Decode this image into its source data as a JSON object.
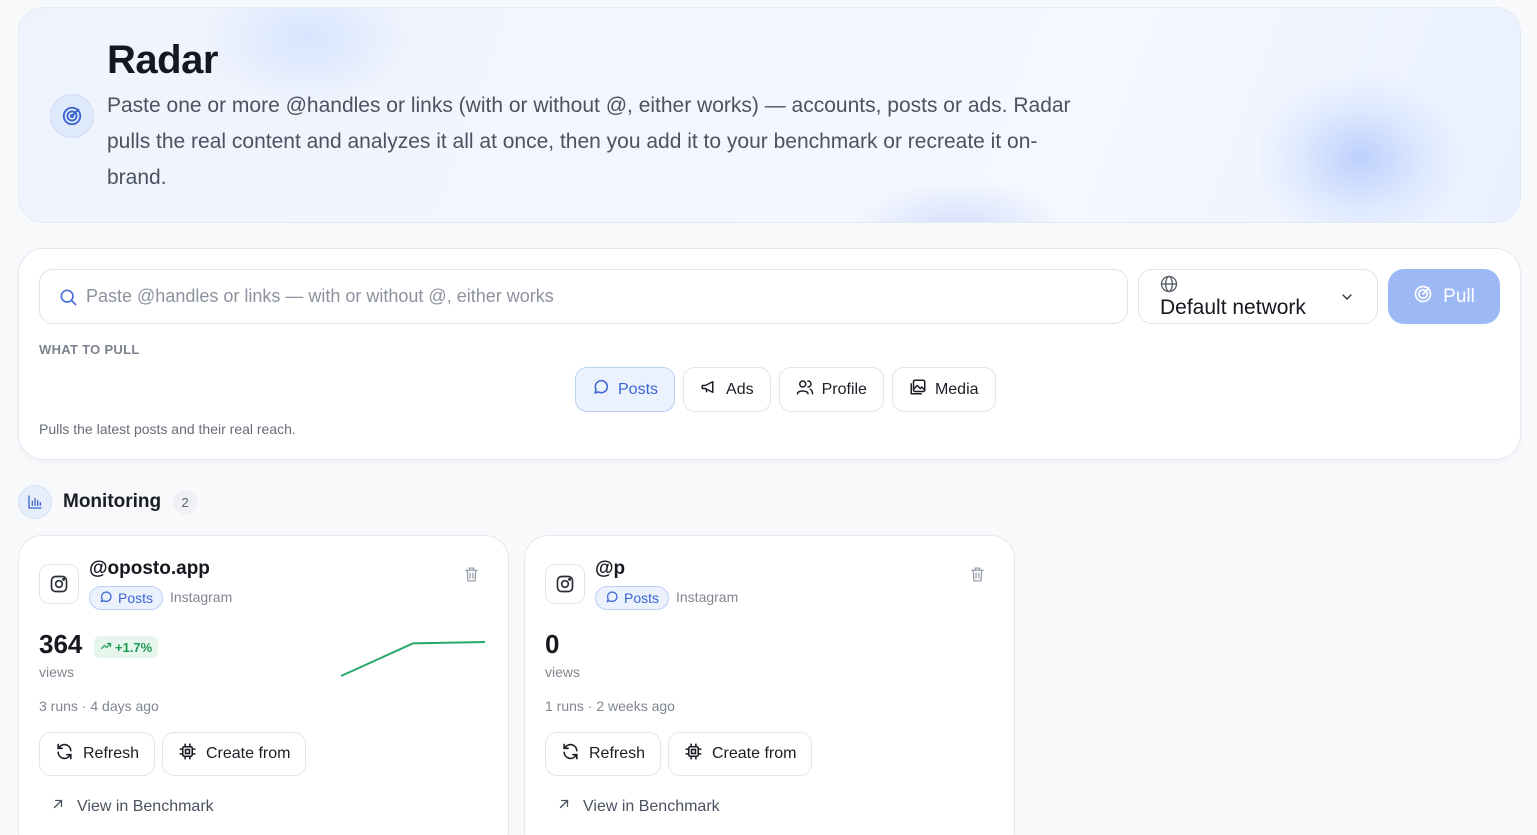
{
  "hero": {
    "title": "Radar",
    "description": "Paste one or more @handles or links (with or without @, either works) — accounts, posts or ads. Radar pulls the real content and analyzes it all at once, then you add it to your benchmark or recreate it on-brand."
  },
  "pull": {
    "search_placeholder": "Paste @handles or links — with or without @, either works",
    "network_value": "Default network",
    "pull_label": "Pull",
    "what_label": "WHAT TO PULL",
    "chips": [
      {
        "label": "Posts",
        "icon": "chat-bubble-icon",
        "active": true
      },
      {
        "label": "Ads",
        "icon": "megaphone-icon",
        "active": false
      },
      {
        "label": "Profile",
        "icon": "users-icon",
        "active": false
      },
      {
        "label": "Media",
        "icon": "images-icon",
        "active": false
      }
    ],
    "hint": "Pulls the latest posts and their real reach."
  },
  "monitoring": {
    "title": "Monitoring",
    "count": "2",
    "cards": [
      {
        "handle": "@oposto.app",
        "type": "Posts",
        "platform": "Instagram",
        "metric": "364",
        "trend": "+1.7%",
        "unit": "views",
        "runs": "3 runs · 4 days ago",
        "refresh": "Refresh",
        "create": "Create from",
        "link": "View in Benchmark",
        "sparkline": [
          0,
          2.3,
          2.4
        ]
      },
      {
        "handle": "@p",
        "type": "Posts",
        "platform": "Instagram",
        "metric": "0",
        "unit": "views",
        "runs": "1 runs · 2 weeks ago",
        "refresh": "Refresh",
        "create": "Create from",
        "link": "View in Benchmark"
      }
    ]
  },
  "colors": {
    "accent": "#3b66d0",
    "pull_button": "#9cb9f5",
    "trend_green": "#1f9a55"
  }
}
